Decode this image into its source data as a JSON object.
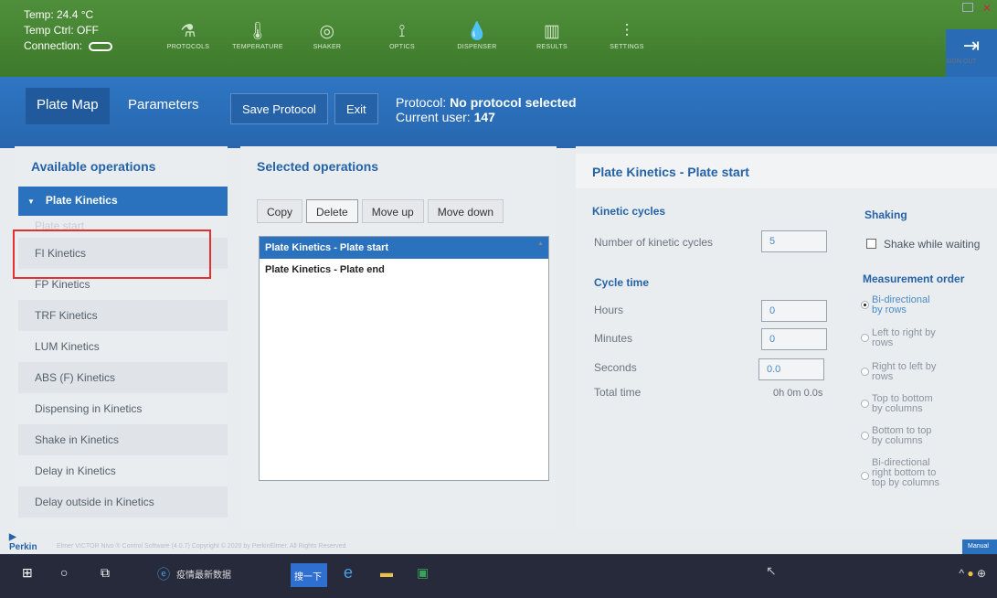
{
  "status": {
    "temp": "Temp: 24.4 °C",
    "temp_ctrl": "Temp Ctrl: OFF",
    "connection": "Connection:"
  },
  "nav": [
    {
      "label": "PROTOCOLS",
      "icon": "flask-icon"
    },
    {
      "label": "TEMPERATURE",
      "icon": "thermometer-icon"
    },
    {
      "label": "SHAKER",
      "icon": "shaker-icon"
    },
    {
      "label": "OPTICS",
      "icon": "optics-icon"
    },
    {
      "label": "DISPENSER",
      "icon": "dispenser-icon"
    },
    {
      "label": "RESULTS",
      "icon": "results-icon"
    },
    {
      "label": "SETTINGS",
      "icon": "settings-icon"
    }
  ],
  "signout": {
    "label": "SIGN OUT"
  },
  "header": {
    "tab_map": "Plate Map",
    "tab_params": "Parameters",
    "save_btn": "Save Protocol",
    "exit_btn": "Exit",
    "protocol_prefix": "Protocol:",
    "protocol_value": "No protocol selected",
    "user_prefix": "Current user:",
    "user_value": "147"
  },
  "available": {
    "title": "Available operations",
    "active": "Plate Kinetics",
    "faded": "Plate start",
    "items": [
      "FI Kinetics",
      "FP Kinetics",
      "TRF Kinetics",
      "LUM Kinetics",
      "ABS (F) Kinetics",
      "Dispensing in Kinetics",
      "Shake in Kinetics",
      "Delay in Kinetics",
      "Delay outside in Kinetics"
    ]
  },
  "selected": {
    "title": "Selected operations",
    "buttons": {
      "copy": "Copy",
      "delete": "Delete",
      "move_up": "Move up",
      "move_down": "Move down"
    },
    "items": [
      "Plate Kinetics - Plate start",
      "Plate Kinetics - Plate end"
    ]
  },
  "details": {
    "title": "Plate Kinetics - Plate start",
    "kinetic_cycles": "Kinetic cycles",
    "num_cycles_label": "Number of kinetic cycles",
    "num_cycles_value": "5",
    "cycle_time": "Cycle time",
    "hours_label": "Hours",
    "hours_value": "0",
    "minutes_label": "Minutes",
    "minutes_value": "0",
    "seconds_label": "Seconds",
    "seconds_value": "0.0",
    "total_label": "Total time",
    "total_value": "0h 0m 0.0s",
    "shaking": "Shaking",
    "shake_label": "Shake while waiting",
    "order_title": "Measurement order",
    "orders": [
      {
        "line1": "Bi-directional",
        "line2": "by rows",
        "line3": ""
      },
      {
        "line1": "Left to right by",
        "line2": "rows",
        "line3": ""
      },
      {
        "line1": "Right to left by",
        "line2": "rows",
        "line3": ""
      },
      {
        "line1": "Top to bottom",
        "line2": "by columns",
        "line3": ""
      },
      {
        "line1": "Bottom to top",
        "line2": "by columns",
        "line3": ""
      },
      {
        "line1": "Bi-directional",
        "line2": "right bottom to",
        "line3": "top by columns"
      }
    ],
    "order_selected_index": 0
  },
  "footer": {
    "logo": "Perkin",
    "copyright": "Elmer VICTOR Nivo ® Control Software (4.0.7) Copyright © 2020 by PerkinElmer. All Rights Reserved",
    "manual": "Manual"
  },
  "taskbar": {
    "news": "疫情最新数据",
    "search": "搜一下"
  },
  "colors": {
    "green": "#3d7a2c",
    "blue": "#2a72bd",
    "highlight_red": "#e5302f"
  }
}
